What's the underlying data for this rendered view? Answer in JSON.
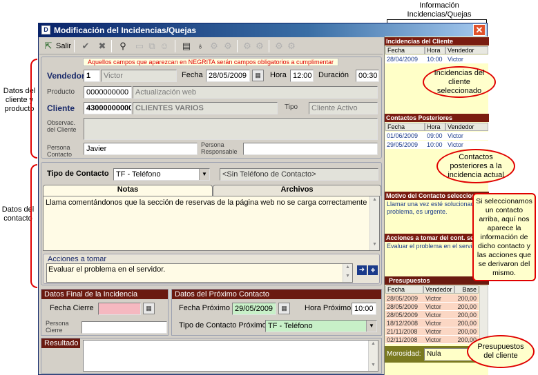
{
  "annotations": {
    "top_right": "Información\nIncidencias/Quejas",
    "left_top": "Datos del\ncliente y\nproducto",
    "left_bottom": "Datos del\ncontacto",
    "callout_incidencias": "Incidencias del\ncliente\nseleccionado",
    "callout_contactos": "Contactos\nposteriores a la\nincidencia actual",
    "callout_motivo": "Si seleccionamos\nun contacto\narriba, aquí nos\naparece la\ninformación de\ndicho contacto y\nlas acciones que\nse derivaron del\nmismo.",
    "callout_presupuestos": "Presupuestos\ndel cliente"
  },
  "window": {
    "title": "Modificación del Incidencias/Quejas",
    "close_label": "✕",
    "app_icon": "D"
  },
  "toolbar": {
    "exit_label": "Salir"
  },
  "notice": "Aquellos campos que aparezcan en NEGRITA serán campos obligatorios a cumplimentar",
  "form": {
    "vendedor_label": "Vendedor",
    "vendedor_code": "1",
    "vendedor_name": "Victor",
    "fecha_label": "Fecha",
    "fecha_value": "28/05/2009",
    "hora_label": "Hora",
    "hora_value": "12:00",
    "duracion_label": "Duración",
    "duracion_value": "00:30",
    "producto_label": "Producto",
    "producto_code": "0000000000",
    "producto_name": "Actualización web",
    "cliente_label": "Cliente",
    "cliente_code": "43000000000",
    "cliente_name": "CLIENTES VARIOS",
    "tipo_label": "Tipo",
    "tipo_value": "Cliente Activo",
    "observac_label": "Observac. del Cliente",
    "persona_contacto_label": "Persona Contacto",
    "persona_contacto_value": "Javier",
    "persona_responsable_label": "Persona Responsable",
    "persona_responsable_value": ""
  },
  "contacto": {
    "tipo_label": "Tipo de Contacto",
    "tipo_value": "TF - Teléfono",
    "telefono_value": "<Sin Teléfono de Contacto>",
    "tab_notas": "Notas",
    "tab_archivos": "Archivos",
    "notas_text": "Llama comentándonos que la sección de reservas de la página web no se carga correctamente",
    "acciones_label": "Acciones a tomar",
    "acciones_text": "Evaluar el problema en el servidor."
  },
  "final": {
    "header": "Datos Final de la Incidencia",
    "fecha_cierre_label": "Fecha Cierre",
    "fecha_cierre_value": "",
    "persona_cierre_label": "Persona Cierre",
    "persona_cierre_value": ""
  },
  "proximo": {
    "header": "Datos del Próximo Contacto",
    "fecha_label": "Fecha Próximo",
    "fecha_value": "29/05/2009",
    "hora_label": "Hora Próximo",
    "hora_value": "10:00",
    "tipo_label": "Tipo de Contacto Próximo",
    "tipo_value": "TF - Teléfono"
  },
  "resultado": {
    "label": "Resultado",
    "value": ""
  },
  "right_panel": {
    "incidencias": {
      "header": "Incidencias del Cliente",
      "columns": [
        "Fecha",
        "Hora",
        "Vendedor"
      ],
      "rows": [
        [
          "28/04/2009",
          "10:00",
          "Victor"
        ]
      ]
    },
    "contactos": {
      "header": "Contactos Posteriores",
      "columns": [
        "Fecha",
        "Hora",
        "Vendedor"
      ],
      "rows": [
        [
          "01/06/2009",
          "09:00",
          "Victor"
        ],
        [
          "29/05/2009",
          "10:00",
          "Victor"
        ]
      ]
    },
    "motivo": {
      "header": "Motivo del Contacto seleccionado",
      "text": "Llamar una vez esté solucionado el problema, es urgente."
    },
    "acciones": {
      "header": "Acciones a tomar del cont. selecc",
      "text": "Evaluar el problema en el servidor."
    },
    "presupuestos": {
      "header": "Presupuestos",
      "columns": [
        "Fecha",
        "Vendedor",
        "Base"
      ],
      "rows": [
        [
          "28/05/2009",
          "Victor",
          "200,00"
        ],
        [
          "28/05/2009",
          "Victor",
          "200,00"
        ],
        [
          "28/05/2009",
          "Victor",
          "200,00"
        ],
        [
          "18/12/2008",
          "Victor",
          "200,00"
        ],
        [
          "21/11/2008",
          "Victor",
          "200,00"
        ],
        [
          "02/11/2008",
          "Victor",
          "200,00"
        ]
      ]
    },
    "morosidad_label": "Morosidad:",
    "morosidad_value": "Nula"
  }
}
